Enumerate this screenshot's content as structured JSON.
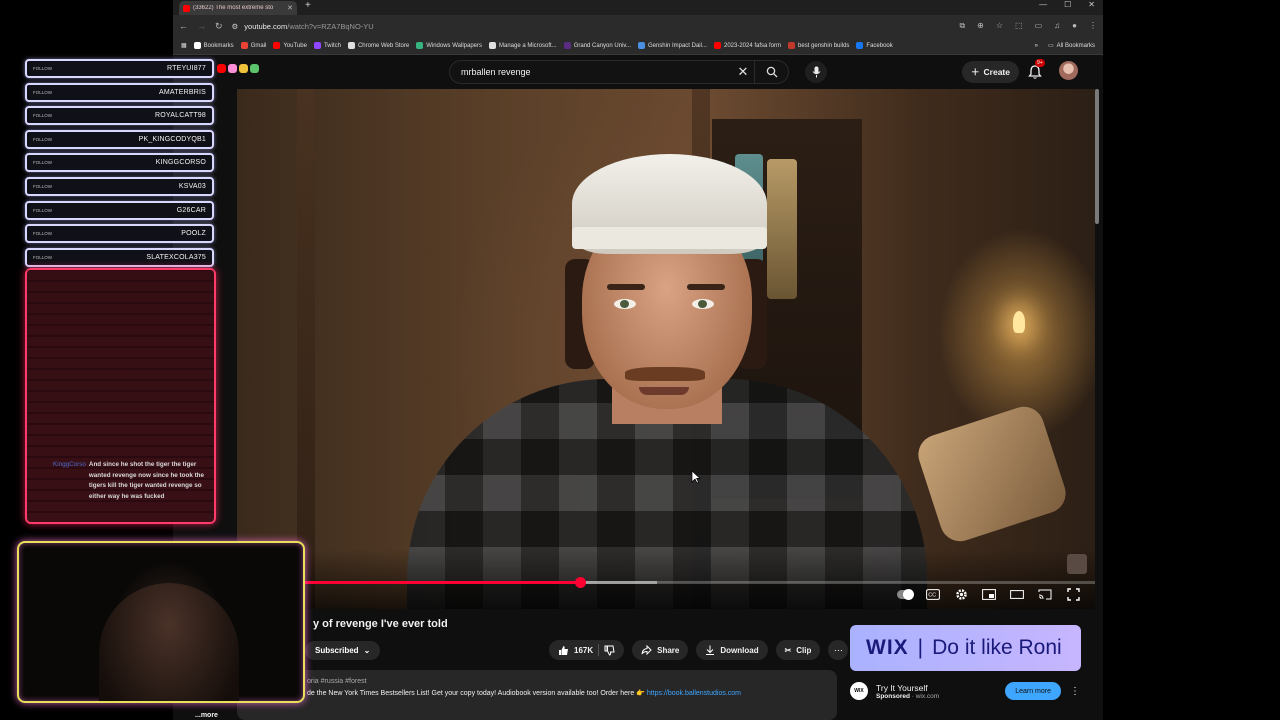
{
  "browser": {
    "tab_title": "(33622) The most extreme sto",
    "url_host": "youtube.com",
    "url_path": "/watch?v=RZA7BqNO-YU",
    "bookmarks": [
      {
        "label": "Bookmarks",
        "color": "#ffffff"
      },
      {
        "label": "Gmail",
        "color": "#ea4335"
      },
      {
        "label": "YouTube",
        "color": "#ff0000"
      },
      {
        "label": "Twitch",
        "color": "#9146ff"
      },
      {
        "label": "Chrome Web Store",
        "color": "#e0e0e0"
      },
      {
        "label": "Windows Wallpapers",
        "color": "#36b37e"
      },
      {
        "label": "Manage a Microsoft...",
        "color": "#e0e0e0"
      },
      {
        "label": "Grand Canyon Univ...",
        "color": "#5a2d82"
      },
      {
        "label": "Genshin Impact Dail...",
        "color": "#4a90e2"
      },
      {
        "label": "2023-2024 fafsa form",
        "color": "#ff0000"
      },
      {
        "label": "best genshin builds",
        "color": "#c0392b"
      },
      {
        "label": "Facebook",
        "color": "#1877f2"
      }
    ],
    "all_bookmarks": "All Bookmarks"
  },
  "yt": {
    "search_query": "mrballen revenge",
    "create_label": "Create",
    "notif_count": "9+",
    "logo_colors": [
      "#ff0000",
      "#ff8fd6",
      "#f0c23a",
      "#5cc46a"
    ]
  },
  "player": {
    "progress_played_fraction": 0.4,
    "progress_buffered_fraction": 0.49
  },
  "video": {
    "title": "y of revenge I've ever told",
    "subscribed_label": "Subscribed",
    "like_count": "167K",
    "share_label": "Share",
    "download_label": "Download",
    "clip_label": "Clip",
    "desc_tags": "oria #russia #forest",
    "desc_line": "de the New York Times Bestsellers List! Get your copy today! Audiobook version available too! Order here 👉",
    "desc_link": "https://book.ballenstudios.com",
    "desc_more": "...more"
  },
  "ad": {
    "brand": "WIX",
    "tagline": "Do it like Roni",
    "logo_text": "WIX",
    "title": "Try It Yourself",
    "sponsored": "Sponsored",
    "domain": "wix.com",
    "cta": "Learn more"
  },
  "overlay": {
    "follow_tag": "FOLLOW",
    "followers": [
      "RTEYUI877",
      "AMATERBRIS",
      "ROYALCATT98",
      "PK_KINGCODYQB1",
      "KINGGCORSO",
      "KSVA03",
      "G26CAR",
      "POOLZ",
      "SLATEXCOLA375"
    ],
    "chat_user": "KinggCorso",
    "chat_text": "And since he shot the tiger the tiger wanted revenge now since he took the tigers kill the tiger wanted revenge so either way he was fucked"
  }
}
